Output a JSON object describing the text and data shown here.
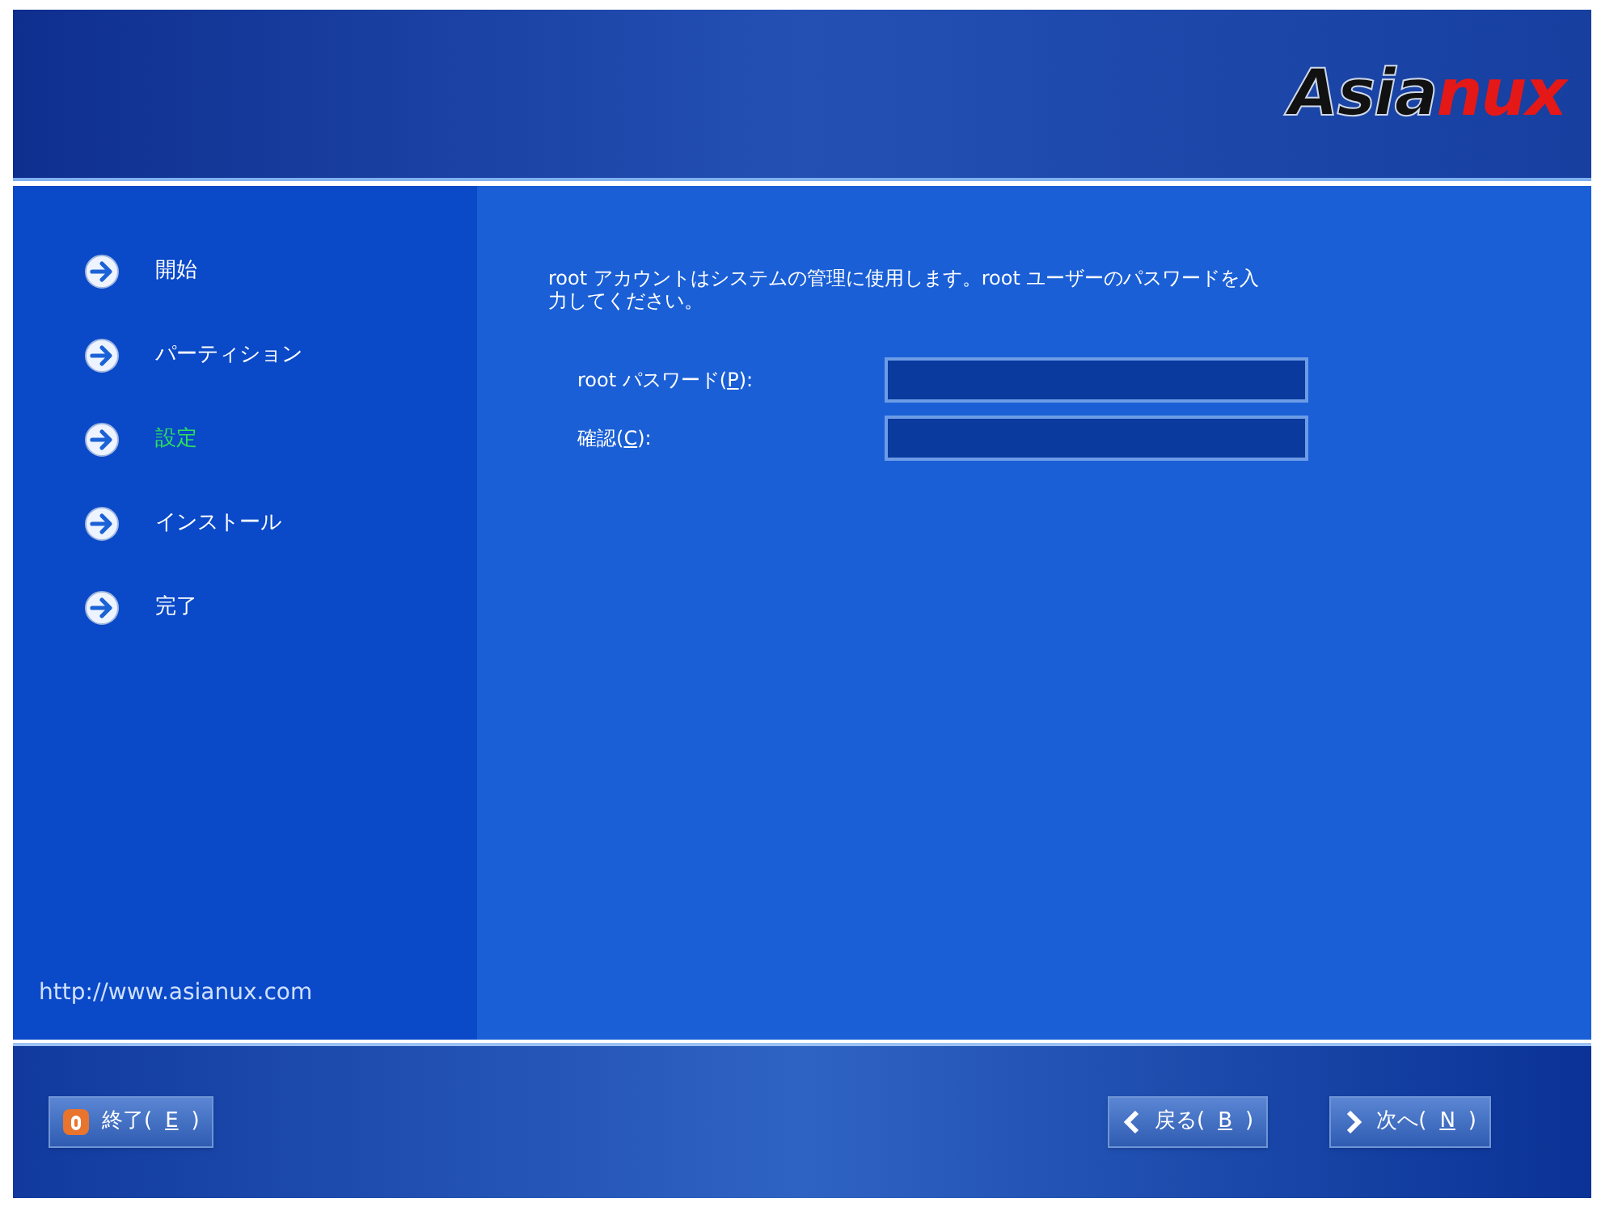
{
  "logo": {
    "left": "Asia",
    "right": "nux"
  },
  "steps": [
    {
      "label": "開始",
      "selected": false
    },
    {
      "label": "パーティション",
      "selected": false
    },
    {
      "label": "設定",
      "selected": true
    },
    {
      "label": "インストール",
      "selected": false
    },
    {
      "label": "完了",
      "selected": false
    }
  ],
  "url": "http://www.asianux.com",
  "intro": "root アカウントはシステムの管理に使用します。root ユーザーのパスワードを入力してください。",
  "fields": [
    {
      "before": "root パスワード(",
      "key": "P",
      "after": "):"
    },
    {
      "before": "確認(",
      "key": "C",
      "after": "):"
    }
  ],
  "buttons": {
    "exit": {
      "before": "終了(",
      "key": "E",
      "after": ")"
    },
    "back": {
      "before": "戻る(",
      "key": "B",
      "after": ")"
    },
    "next": {
      "before": "次へ(",
      "key": "N",
      "after": ")"
    }
  }
}
